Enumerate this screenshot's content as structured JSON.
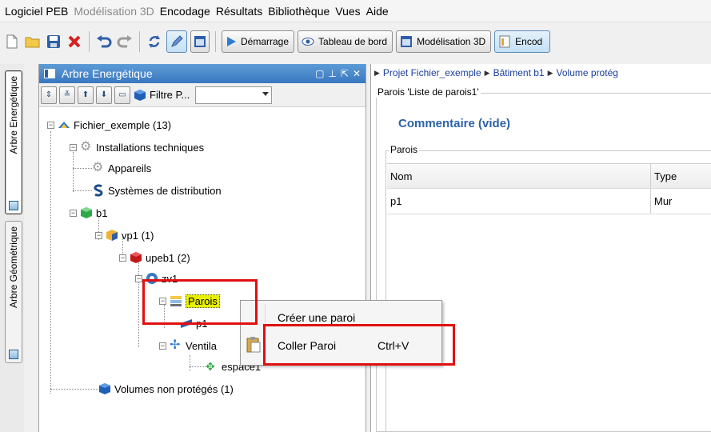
{
  "menubar": {
    "items": [
      "Logiciel PEB",
      "Modélisation 3D",
      "Encodage",
      "Résultats",
      "Bibliothèque",
      "Vues",
      "Aide"
    ]
  },
  "toolbar": {
    "buttons": [
      "Démarrage",
      "Tableau de bord",
      "Modélisation 3D",
      "Encod"
    ]
  },
  "sidetabs": {
    "tab1": "Arbre Energétique",
    "tab2": "Arbre Géométrique"
  },
  "left_panel": {
    "title": "Arbre Energétique",
    "filter_label": "Filtre P..."
  },
  "tree": {
    "root": "Fichier_exemple (13)",
    "installations": "Installations techniques",
    "appareils": "Appareils",
    "distribution": "Systèmes de distribution",
    "b1": "b1",
    "vp1": "vp1 (1)",
    "upeb1": "upeb1 (2)",
    "zv1": "zv1",
    "parois": "Parois",
    "p1": "p1",
    "ventil": "Ventila",
    "espace1": "espace1",
    "volumes_np": "Volumes non protégés (1)"
  },
  "right_panel": {
    "breadcrumb": [
      "Projet Fichier_exemple",
      "Bâtiment b1",
      "Volume protég"
    ],
    "group_title": "Parois 'Liste de parois1'",
    "comment": "Commentaire (vide)",
    "parois_label": "Parois",
    "table": {
      "headers": [
        "Nom",
        "Type"
      ],
      "rows": [
        [
          "p1",
          "Mur"
        ]
      ]
    }
  },
  "context_menu": {
    "item1": "Créer une paroi",
    "item2": "Coller Paroi",
    "item2_shortcut": "Ctrl+V"
  },
  "colors": {
    "highlight_box": "#e01010",
    "selection": "#e8f000",
    "panel_title": "#3a78c0",
    "comment_text": "#2c62a8"
  }
}
